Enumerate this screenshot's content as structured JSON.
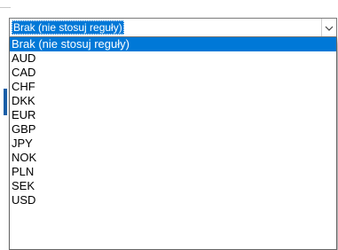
{
  "combo": {
    "value": "Brak (nie stosuj reguły)",
    "dropdown_icon": "chevron-down-icon"
  },
  "options": [
    "Brak (nie stosuj reguły)",
    "AUD",
    "CAD",
    "CHF",
    "DKK",
    "EUR",
    "GBP",
    "JPY",
    "NOK",
    "PLN",
    "SEK",
    "USD"
  ],
  "selected_index": 0,
  "colors": {
    "selection": "#0078d7",
    "selection_text": "#ffffff",
    "text": "#000000",
    "border": "#7a7a7a"
  }
}
